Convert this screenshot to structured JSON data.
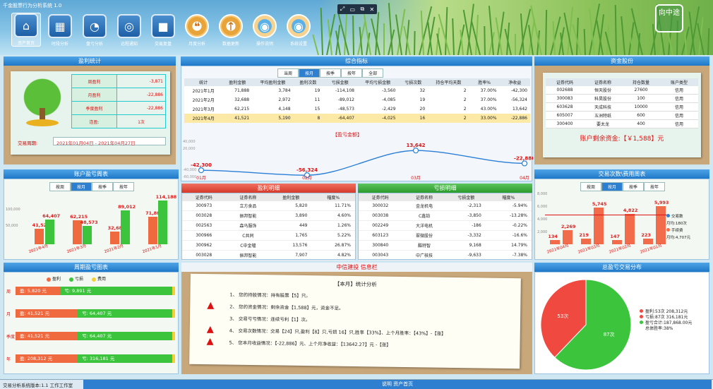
{
  "app": {
    "title": "千金股票行为分析系统 1.0",
    "logo": "向中途"
  },
  "toolbar": [
    {
      "label": "资产首页",
      "icon": "home-icon",
      "sel": true
    },
    {
      "label": "时段分析",
      "icon": "chart-icon"
    },
    {
      "label": "盘亏分析",
      "icon": "gauge-icon"
    },
    {
      "label": "远程通知",
      "icon": "wifi-icon"
    },
    {
      "label": "交易复盘",
      "icon": "square-icon"
    },
    {
      "label": "月度分析",
      "icon": "chat-icon"
    },
    {
      "label": "数据更新",
      "icon": "up-arrow-icon"
    },
    {
      "label": "操作说明",
      "icon": "disc-icon"
    },
    {
      "label": "系统设置",
      "icon": "disc-icon"
    }
  ],
  "panels": {
    "profit": "盈利统计",
    "overview": "综合指标",
    "holdings": "资金股份",
    "account": "账户盈亏周表",
    "trades": "交易次数\\费用周表",
    "week": "周期盈亏图表",
    "news": "中信建投 信息栏",
    "dist": "总盈亏交易分布",
    "winlist": "盈利明细",
    "losslist": "亏损明细",
    "amount": "【盈亏金额】"
  },
  "profit": {
    "rows": [
      [
        "周盈利",
        "-3,871"
      ],
      [
        "月盈利",
        "-22,886"
      ],
      [
        "季度盈利",
        "-22,886"
      ],
      [
        "连盈:",
        "1次"
      ]
    ],
    "period_label": "交易周期:",
    "period": "2021年01月04日 - 2021年04月27日"
  },
  "overview": {
    "tabs": [
      "当周",
      "按月",
      "按季",
      "按年",
      "全部"
    ],
    "head": [
      "统计",
      "盈利金额",
      "平均盈利金额",
      "盈利次数",
      "亏损金额",
      "平均亏损金额",
      "亏损次数",
      "持仓平均天数",
      "胜率%",
      "净收益"
    ],
    "rows": [
      [
        "2021年1月",
        "71,888",
        "3,784",
        "19",
        "-114,108",
        "-3,560",
        "32",
        "2",
        "37.00%",
        "-42,300"
      ],
      [
        "2021年2月",
        "32,688",
        "2,972",
        "11",
        "-89,012",
        "-4,085",
        "19",
        "2",
        "37.00%",
        "-56,324"
      ],
      [
        "2021年3月",
        "62,215",
        "4,148",
        "15",
        "-48,573",
        "-2,429",
        "20",
        "2",
        "43.00%",
        "13,642"
      ],
      [
        "2021年4月",
        "41,521",
        "5,190",
        "8",
        "-64,407",
        "-4,025",
        "16",
        "2",
        "33.00%",
        "-22,886"
      ]
    ]
  },
  "holdings": {
    "head": [
      "证券代码",
      "证券名称",
      "持仓数量",
      "账户类型"
    ],
    "rows": [
      [
        "002688",
        "恒天股份",
        "27600",
        "信用"
      ],
      [
        "300083",
        "科昊股份",
        "100",
        "信用"
      ],
      [
        "603628",
        "天成科技",
        "10000",
        "信用"
      ],
      [
        "605007",
        "五洲特纸",
        "600",
        "信用"
      ],
      [
        "300400",
        "要太龙",
        "400",
        "信用"
      ]
    ],
    "cash": "账户剩余资金:【￥1,588】元"
  },
  "chart_data": [
    {
      "type": "line",
      "title": "【盈亏金额】",
      "categories": [
        "01月",
        "02月",
        "03月",
        "04月"
      ],
      "values": [
        -42300,
        -56324,
        13642,
        -22886
      ],
      "ylim": [
        -60000,
        40000
      ],
      "yticks": [
        "40,000",
        "20,000",
        "-40,000",
        "-60,000"
      ]
    },
    {
      "type": "bar",
      "title": "账户盈亏周表",
      "tabs": [
        "按周",
        "按月",
        "按季",
        "按年"
      ],
      "categories": [
        "2021年4月",
        "2021年3月",
        "2021年2月",
        "2021年1月"
      ],
      "series": [
        {
          "name": "亏",
          "values": [
            41521,
            62215,
            32688,
            71888
          ]
        },
        {
          "name": "盈",
          "values": [
            64407,
            48573,
            89012,
            114188
          ]
        }
      ],
      "yticks": [
        "100,000",
        "50,000"
      ]
    },
    {
      "type": "bar",
      "title": "交易次数\\费用周表",
      "tabs": [
        "按周",
        "按月",
        "按季",
        "按年"
      ],
      "categories": [
        "2021年04月",
        "2021年03月",
        "2021年02月",
        "2021年01月"
      ],
      "series": [
        {
          "name": "次数",
          "values": [
            134,
            219,
            147,
            223
          ]
        },
        {
          "name": "费用",
          "values": [
            2269,
            5745,
            4822,
            5993
          ]
        }
      ],
      "legend": [
        "交易数",
        "月均:180次",
        "手续费",
        "月均:4,707元"
      ],
      "yticks": [
        "8,000",
        "6,000",
        "4,000",
        "2,000"
      ]
    },
    {
      "type": "pie",
      "title": "总盈亏交易分布",
      "series": [
        {
          "name": "盈",
          "values": [
            87,
            53
          ]
        }
      ],
      "labels": [
        "87次",
        "53次"
      ],
      "legend": [
        "盈利:53次 208,312元",
        "亏损:87次 316,181元",
        "盈亏合计:187,868.00元",
        "总体胜率:38%"
      ]
    }
  ],
  "winlist": {
    "head": [
      "证券代码",
      "证券名称",
      "盈利金额",
      "幅度%"
    ],
    "rows": [
      [
        "300973",
        "立方食品",
        "5,820",
        "11.71%"
      ],
      [
        "003028",
        "振邦智能",
        "3,890",
        "4.60%"
      ],
      [
        "002563",
        "森马服饰",
        "449",
        "1.26%"
      ],
      [
        "300966",
        "C共同",
        "1,765",
        "5.22%"
      ],
      [
        "300962",
        "C中金辐",
        "13,576",
        "26.87%"
      ],
      [
        "003028",
        "振邦智能",
        "7,907",
        "4.82%"
      ]
    ]
  },
  "losslist": {
    "head": [
      "证券代码",
      "证券名称",
      "亏损金额",
      "幅度%"
    ],
    "rows": [
      [
        "300032",
        "金龙机电",
        "-2,313",
        "-5.94%"
      ],
      [
        "003038",
        "C鑫铂",
        "-3,850",
        "-13.28%"
      ],
      [
        "002249",
        "大洋电机",
        "-186",
        "-0.22%"
      ],
      [
        "603123",
        "翠微股份",
        "-3,332",
        "-16.6%"
      ],
      [
        "300840",
        "酷特智",
        "9,168",
        "14.79%"
      ],
      [
        "003043",
        "中广核技",
        "-9,633",
        "-7.38%"
      ]
    ]
  },
  "week": {
    "legend": [
      "盈利",
      "亏损",
      "费用"
    ],
    "rows": [
      {
        "label": "周",
        "win": "盈: 5,820 元",
        "loss": "亏: 9,891 元",
        "w": 28
      },
      {
        "label": "月",
        "win": "盈: 41,521 元",
        "loss": "亏: 64,407 元",
        "w": 39
      },
      {
        "label": "季度",
        "win": "盈: 41,521 元",
        "loss": "亏: 64,407 元",
        "w": 39
      },
      {
        "label": "年",
        "win": "盈: 208,312 元",
        "loss": "亏: 316,181 元",
        "w": 39
      }
    ]
  },
  "news": {
    "head": "【本月】统计分析",
    "items": [
      "1、 您的持股情况：持有股票【5】只。",
      "2、 您的资金情况：剩余资金【1,588】元，资金不足。",
      "3、 交易亏亏情况：连续亏利【1】次。",
      "4、 交易次数情况：交易【24】只,盈利【8】只,亏损 16】只,胜率【33%】、上个月胜率：【43%】-【涨】",
      "5、 您本月收益情况：【-22,886】元、上个月净收益：【13642.27】元 -【涨】"
    ]
  },
  "status": {
    "left": "交易分析系统版本:1.1  工作工作室",
    "center": "说明  资产首页"
  }
}
